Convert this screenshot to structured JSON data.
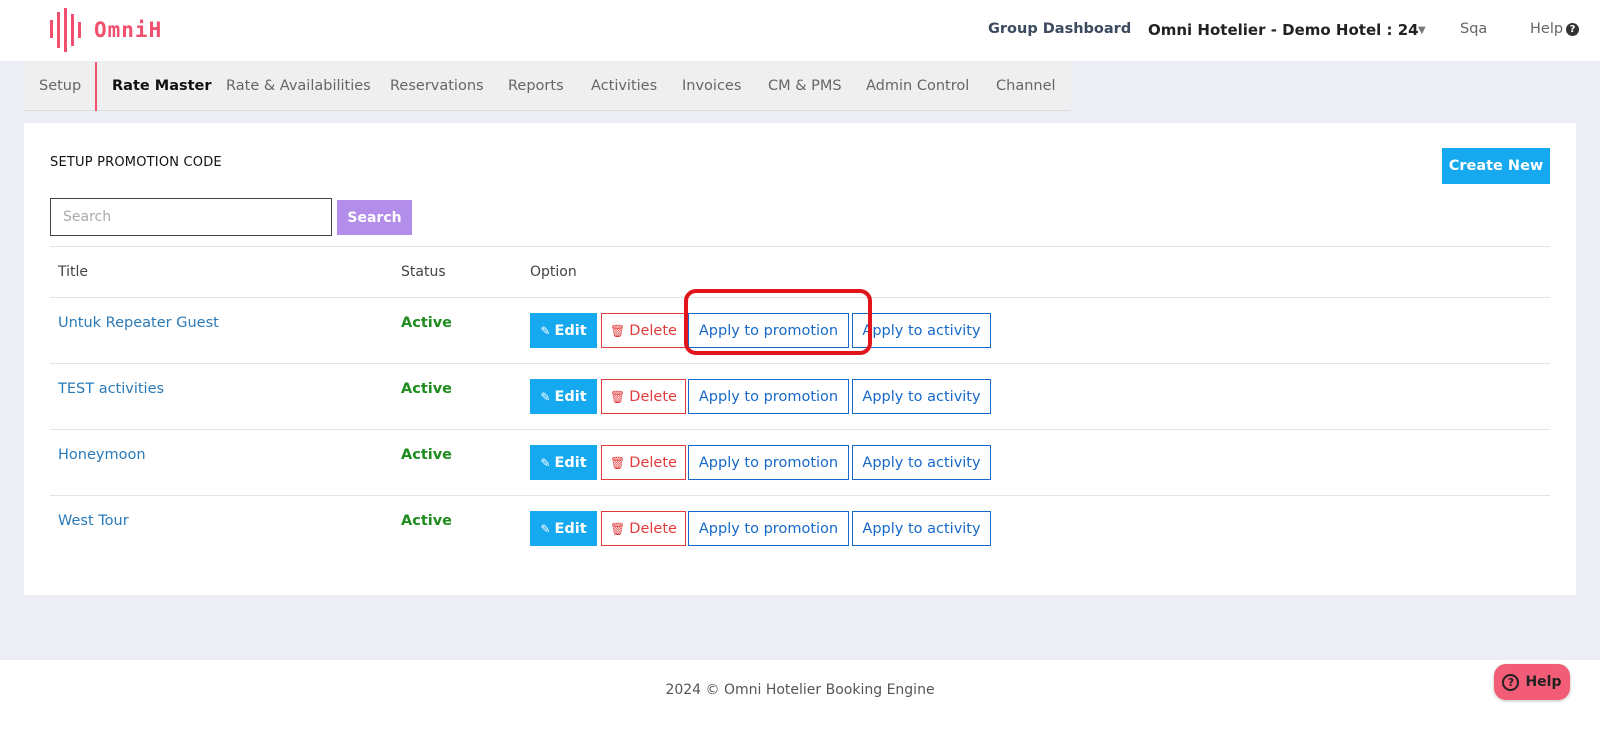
{
  "header": {
    "logo_text": "OmniH",
    "group_dashboard": "Group Dashboard",
    "hotel_selector": "Omni Hotelier - Demo Hotel : 24",
    "user": "Sqa",
    "help": "Help"
  },
  "nav": {
    "items": [
      "Setup",
      "Rate Master",
      "Rate & Availabilities",
      "Reservations",
      "Reports",
      "Activities",
      "Invoices",
      "CM & PMS",
      "Admin Control",
      "Channel"
    ],
    "active": "Rate Master"
  },
  "page": {
    "title": "SETUP PROMOTION CODE",
    "create_new": "Create New",
    "search_placeholder": "Search",
    "search_button": "Search"
  },
  "table": {
    "headers": [
      "Title",
      "Status",
      "Option"
    ],
    "rows": [
      {
        "title": "Untuk Repeater Guest",
        "status": "Active"
      },
      {
        "title": "TEST activities",
        "status": "Active"
      },
      {
        "title": "Honeymoon",
        "status": "Active"
      },
      {
        "title": "West Tour",
        "status": "Active"
      }
    ],
    "actions": {
      "edit": "Edit",
      "delete": "Delete",
      "apply_promotion": "Apply to promotion",
      "apply_activity": "Apply to activity"
    }
  },
  "footer": {
    "text": "2024 © Omni Hotelier Booking Engine",
    "help_button": "Help"
  },
  "colors": {
    "brand": "#f0506e",
    "primary": "#16a9ef",
    "link": "#2a7ab8",
    "active_status": "#1e8c1e",
    "danger": "#e23b3b",
    "highlight": "#e2141c"
  }
}
